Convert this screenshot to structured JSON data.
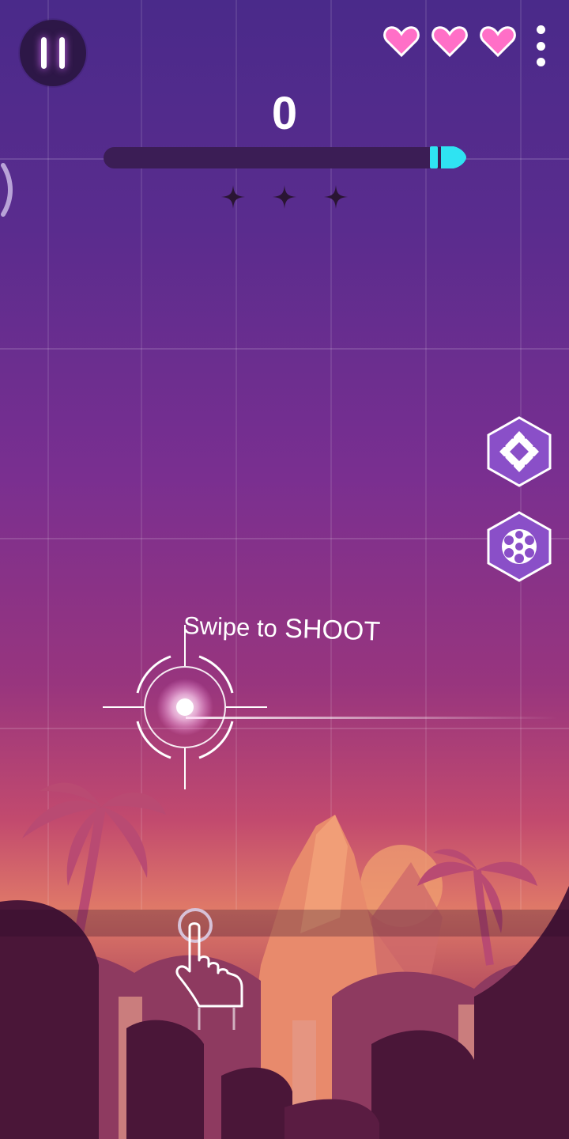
{
  "hud": {
    "score": "0",
    "lives": 3,
    "progress": 1.0,
    "stars_earned": 0,
    "stars_total": 3
  },
  "icons": {
    "pause": "pause-icon",
    "heart": "heart-icon",
    "menu": "more-vertical-icon",
    "marker": "bullet-icon",
    "star": "star-icon",
    "powerup_1": "diamond-powerup-icon",
    "powerup_2": "revolver-cylinder-icon",
    "crosshair": "crosshair-icon",
    "hand": "hand-pointer-icon"
  },
  "tutorial": {
    "swipe_prefix": "Swipe to",
    "swipe_action": "SHOOT"
  },
  "colors": {
    "heart": "#ff6fc7",
    "marker": "#2fe3f2",
    "star_empty": "#2a1533",
    "pause_bg": "#2d1747",
    "track": "#3b1d55"
  }
}
